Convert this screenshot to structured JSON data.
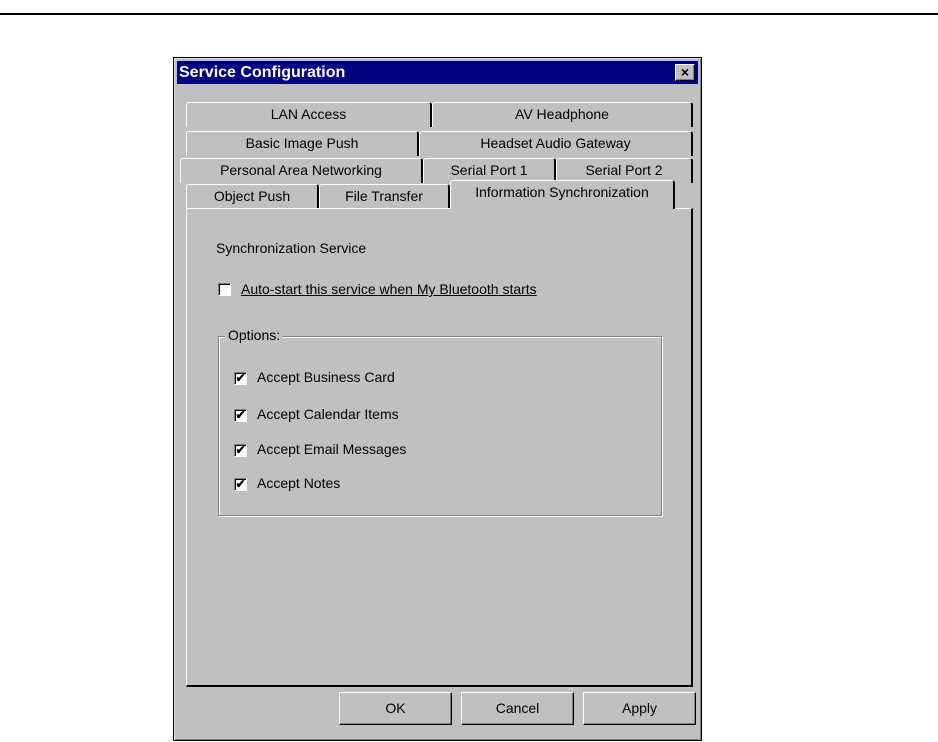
{
  "window": {
    "title": "Service Configuration",
    "close_glyph": "×"
  },
  "tabs": {
    "row1": [
      "LAN Access",
      "AV Headphone"
    ],
    "row2": [
      "Basic Image Push",
      "Headset Audio Gateway"
    ],
    "row3": [
      "Personal Area Networking",
      "Serial Port 1",
      "Serial Port 2"
    ],
    "row4": [
      "Object Push",
      "File Transfer",
      "Information Synchronization"
    ],
    "active": "Information Synchronization"
  },
  "panel": {
    "section_title": "Synchronization Service",
    "autostart": {
      "label": "Auto-start this service when My Bluetooth starts",
      "checked": false
    },
    "options": {
      "legend": "Options:",
      "items": [
        {
          "label": "Accept Business Card",
          "checked": true
        },
        {
          "label": "Accept Calendar Items",
          "checked": true
        },
        {
          "label": "Accept Email Messages",
          "checked": true
        },
        {
          "label": "Accept Notes",
          "checked": true
        }
      ]
    }
  },
  "buttons": {
    "ok": "OK",
    "cancel": "Cancel",
    "apply": "Apply"
  },
  "check_glyph": "✔"
}
